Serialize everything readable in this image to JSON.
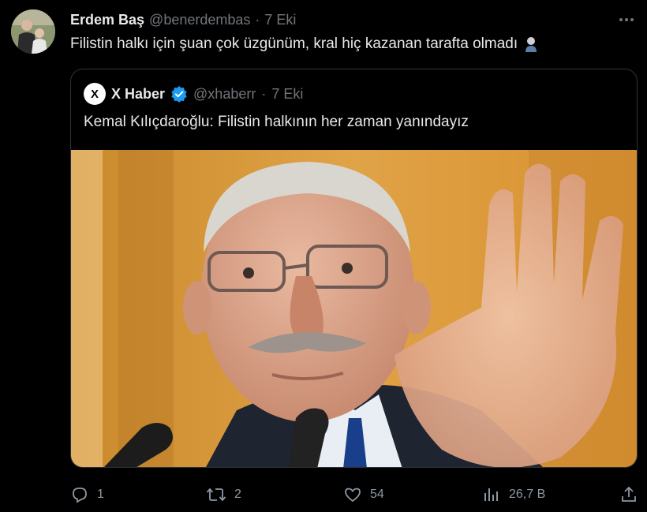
{
  "tweet": {
    "author_name": "Erdem Baş",
    "author_handle": "@benerdembas",
    "separator": "·",
    "date": "7 Eki",
    "text": "Filistin halkı için şuan çok üzgünüm, kral hiç kazanan tarafta olmadı",
    "emoji_icon": "person-facepalm-emoji"
  },
  "quote": {
    "author_name": "X Haber",
    "author_handle": "@xhaberr",
    "separator": "·",
    "date": "7 Eki",
    "text": "Kemal Kılıçdaroğlu: Filistin halkının her zaman yanındayız",
    "logo_text": "X",
    "verified_color": "#1d9bf0"
  },
  "actions": {
    "replies": "1",
    "reposts": "2",
    "likes": "54",
    "views": "26,7 B"
  },
  "colors": {
    "background": "#000000",
    "text": "#e7e9ea",
    "muted": "#71767b",
    "border": "#2f3336"
  }
}
